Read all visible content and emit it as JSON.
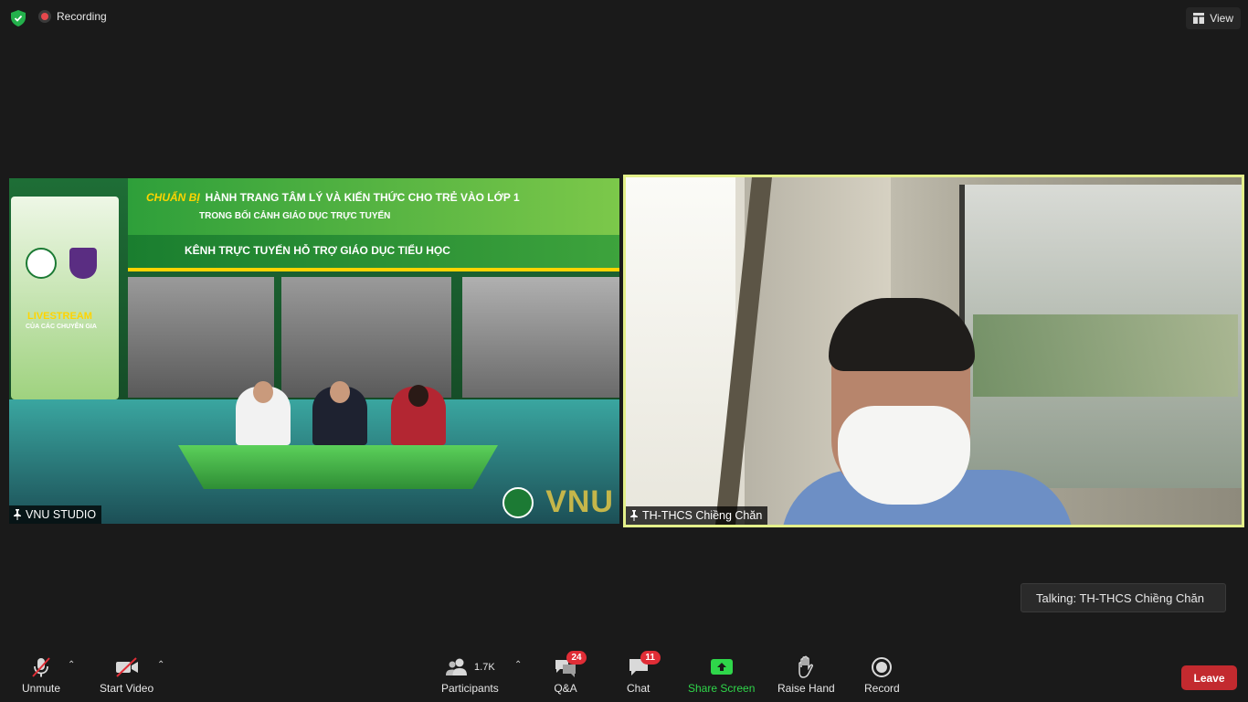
{
  "topbar": {
    "recording_label": "Recording",
    "view_label": "View"
  },
  "tiles": {
    "left": {
      "name": "VNU STUDIO",
      "scene": {
        "banner_prefix": "CHUẨN BỊ",
        "banner_title": "HÀNH TRANG TÂM LÝ VÀ KIẾN THỨC CHO TRẺ VÀO LỚP 1",
        "banner_subtitle": "TRONG BỐI CẢNH GIÁO DỤC TRỰC TUYẾN",
        "strip_title": "KÊNH TRỰC TUYẾN HỖ TRỢ GIÁO DỤC TIỂU HỌC",
        "livestream": "LIVESTREAM",
        "livestream_sub": "CỦA CÁC CHUYÊN GIA",
        "vnu": "VNU"
      }
    },
    "right": {
      "name": "TH-THCS Chiềng Chăn"
    }
  },
  "talking": "Talking: TH-THCS Chiềng Chăn",
  "toolbar": {
    "unmute": "Unmute",
    "start_video": "Start Video",
    "participants": "Participants",
    "participants_count": "1.7K",
    "qa": "Q&A",
    "qa_badge": "24",
    "chat": "Chat",
    "chat_badge": "11",
    "share_screen": "Share Screen",
    "raise_hand": "Raise Hand",
    "record": "Record",
    "leave": "Leave"
  },
  "colors": {
    "active_speaker_border": "#e4f08a",
    "share_green": "#2fd64a",
    "leave_red": "#c32a2f",
    "badge_red": "#e02d36"
  }
}
